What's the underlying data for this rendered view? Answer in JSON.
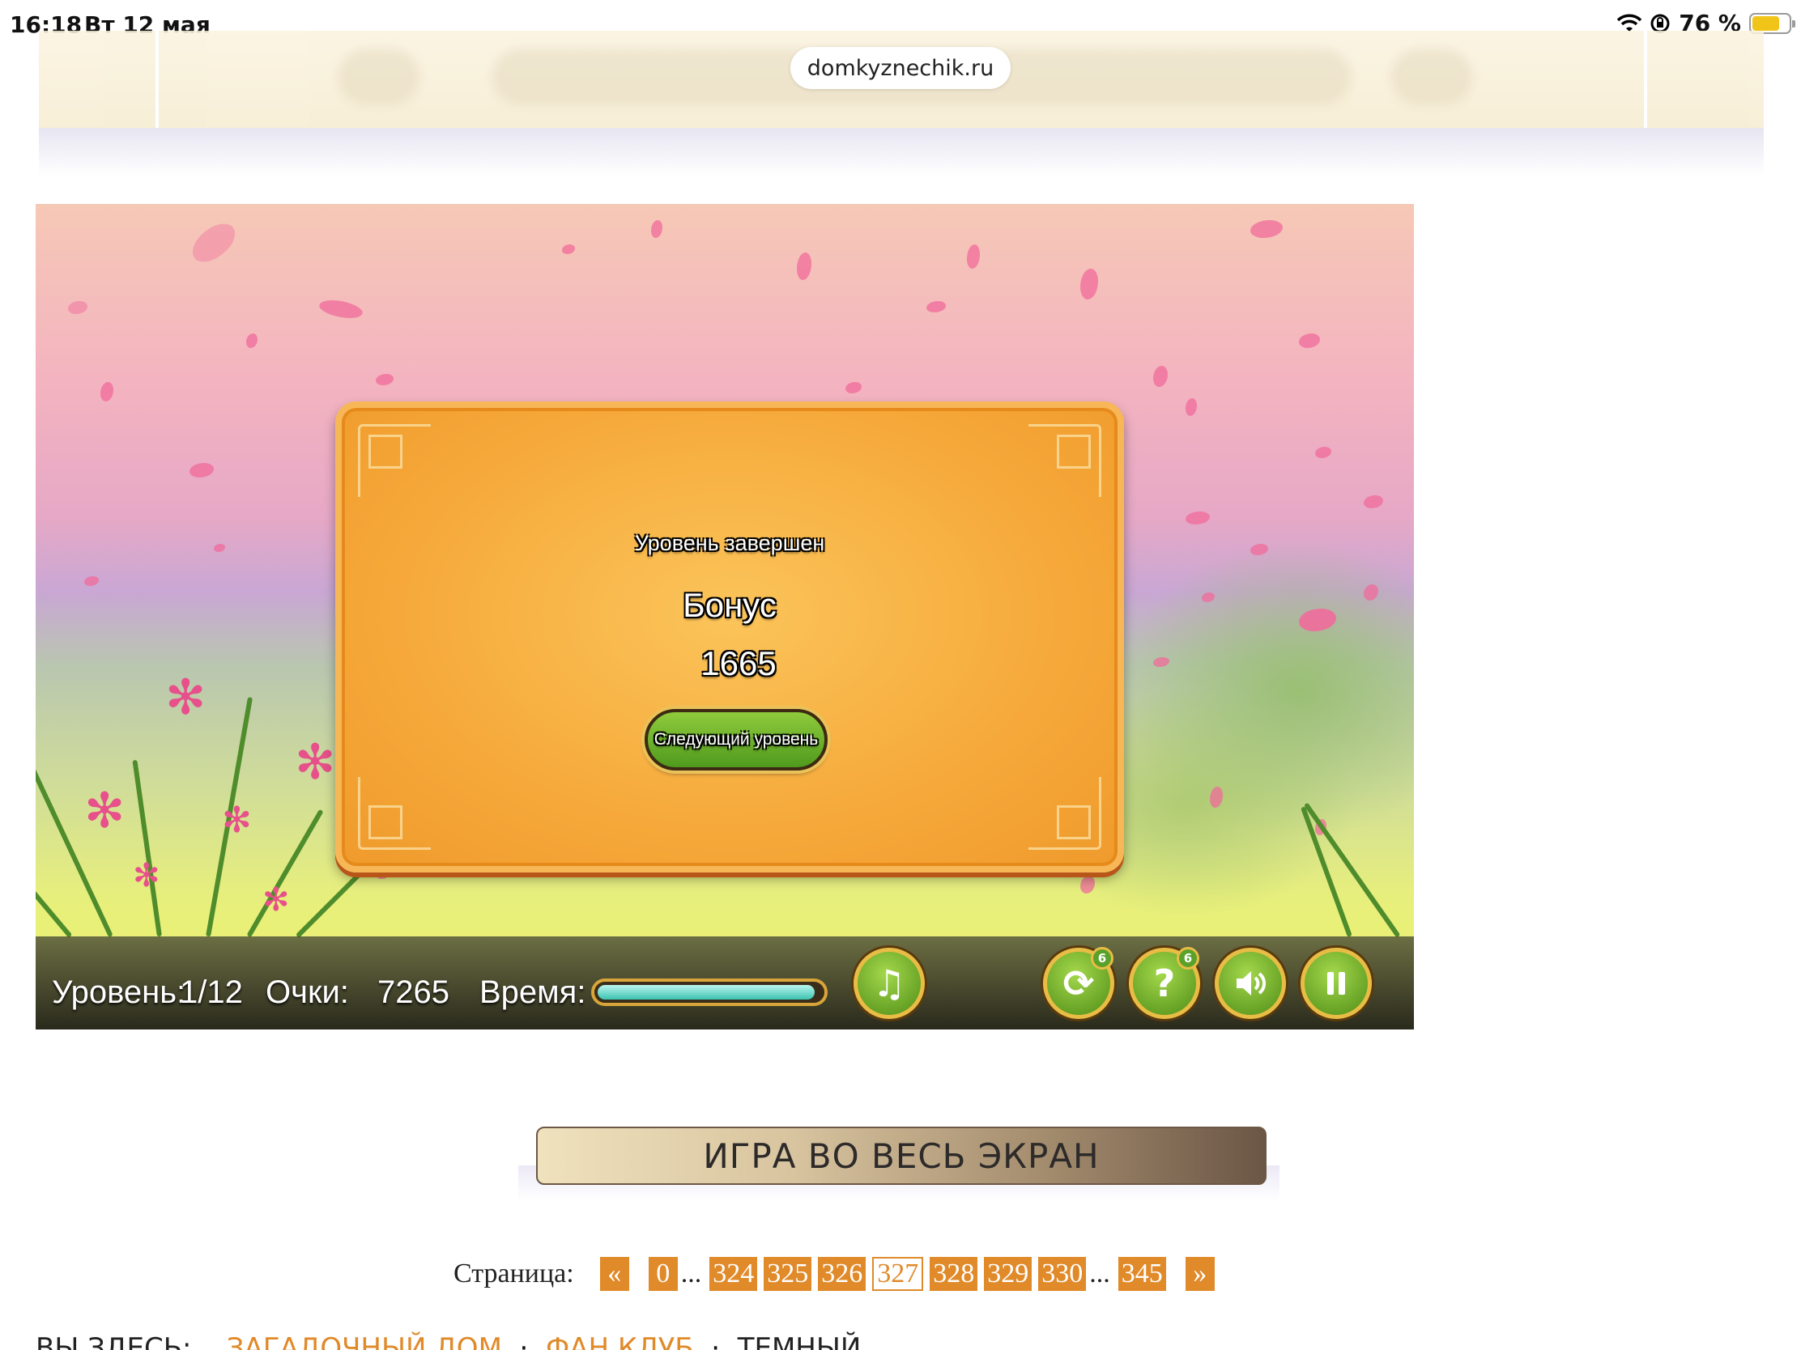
{
  "status_bar": {
    "time": "16:18",
    "date": "Вт 12 мая",
    "battery": "76 %",
    "battery_level": 0.76,
    "icons": [
      "wifi-icon",
      "orientation-lock-icon",
      "battery-icon"
    ]
  },
  "browser": {
    "url": "domkyznechik.ru"
  },
  "game": {
    "dialog": {
      "title": "Уровень завершен",
      "bonus_label": "Бонус",
      "bonus_value": "1665",
      "next_button": "Следующий уровень"
    },
    "hud": {
      "level_label": "Уровень:",
      "level_value": "1/12",
      "score_label": "Очки:",
      "score_value": "7265",
      "time_label": "Время:",
      "time_remaining": 0.97,
      "buttons": [
        {
          "name": "music-button",
          "icon": "music-note-icon",
          "glyph": "♫"
        },
        {
          "name": "shuffle-button",
          "icon": "shuffle-icon",
          "glyph": "⟳",
          "badge": "6"
        },
        {
          "name": "hint-button",
          "icon": "question-icon",
          "glyph": "?",
          "badge": "6"
        },
        {
          "name": "sound-button",
          "icon": "speaker-icon",
          "glyph": "🔊"
        },
        {
          "name": "pause-button",
          "icon": "pause-icon",
          "glyph": "II"
        }
      ]
    },
    "colors": {
      "panel": "#f6a93a",
      "button_green": "#6bb82a",
      "gold": "#e9bd45"
    }
  },
  "fullscreen_button": "ИГРА ВО ВЕСЬ ЭКРАН",
  "pagination": {
    "label": "Страница:",
    "prev": "«",
    "first": "0",
    "ellipsis": "...",
    "pages": [
      "324",
      "325",
      "326",
      "327",
      "328",
      "329",
      "330"
    ],
    "current": "327",
    "last": "345",
    "next": "»"
  },
  "breadcrumb": {
    "prefix": "ВЫ ЗДЕСЬ:",
    "items": [
      "ЗАГАДОЧНЫЙ ДОМ",
      "ФАН КЛУБ",
      "ТЕМНЫЙ"
    ]
  },
  "accent_color": "#e08a2a"
}
